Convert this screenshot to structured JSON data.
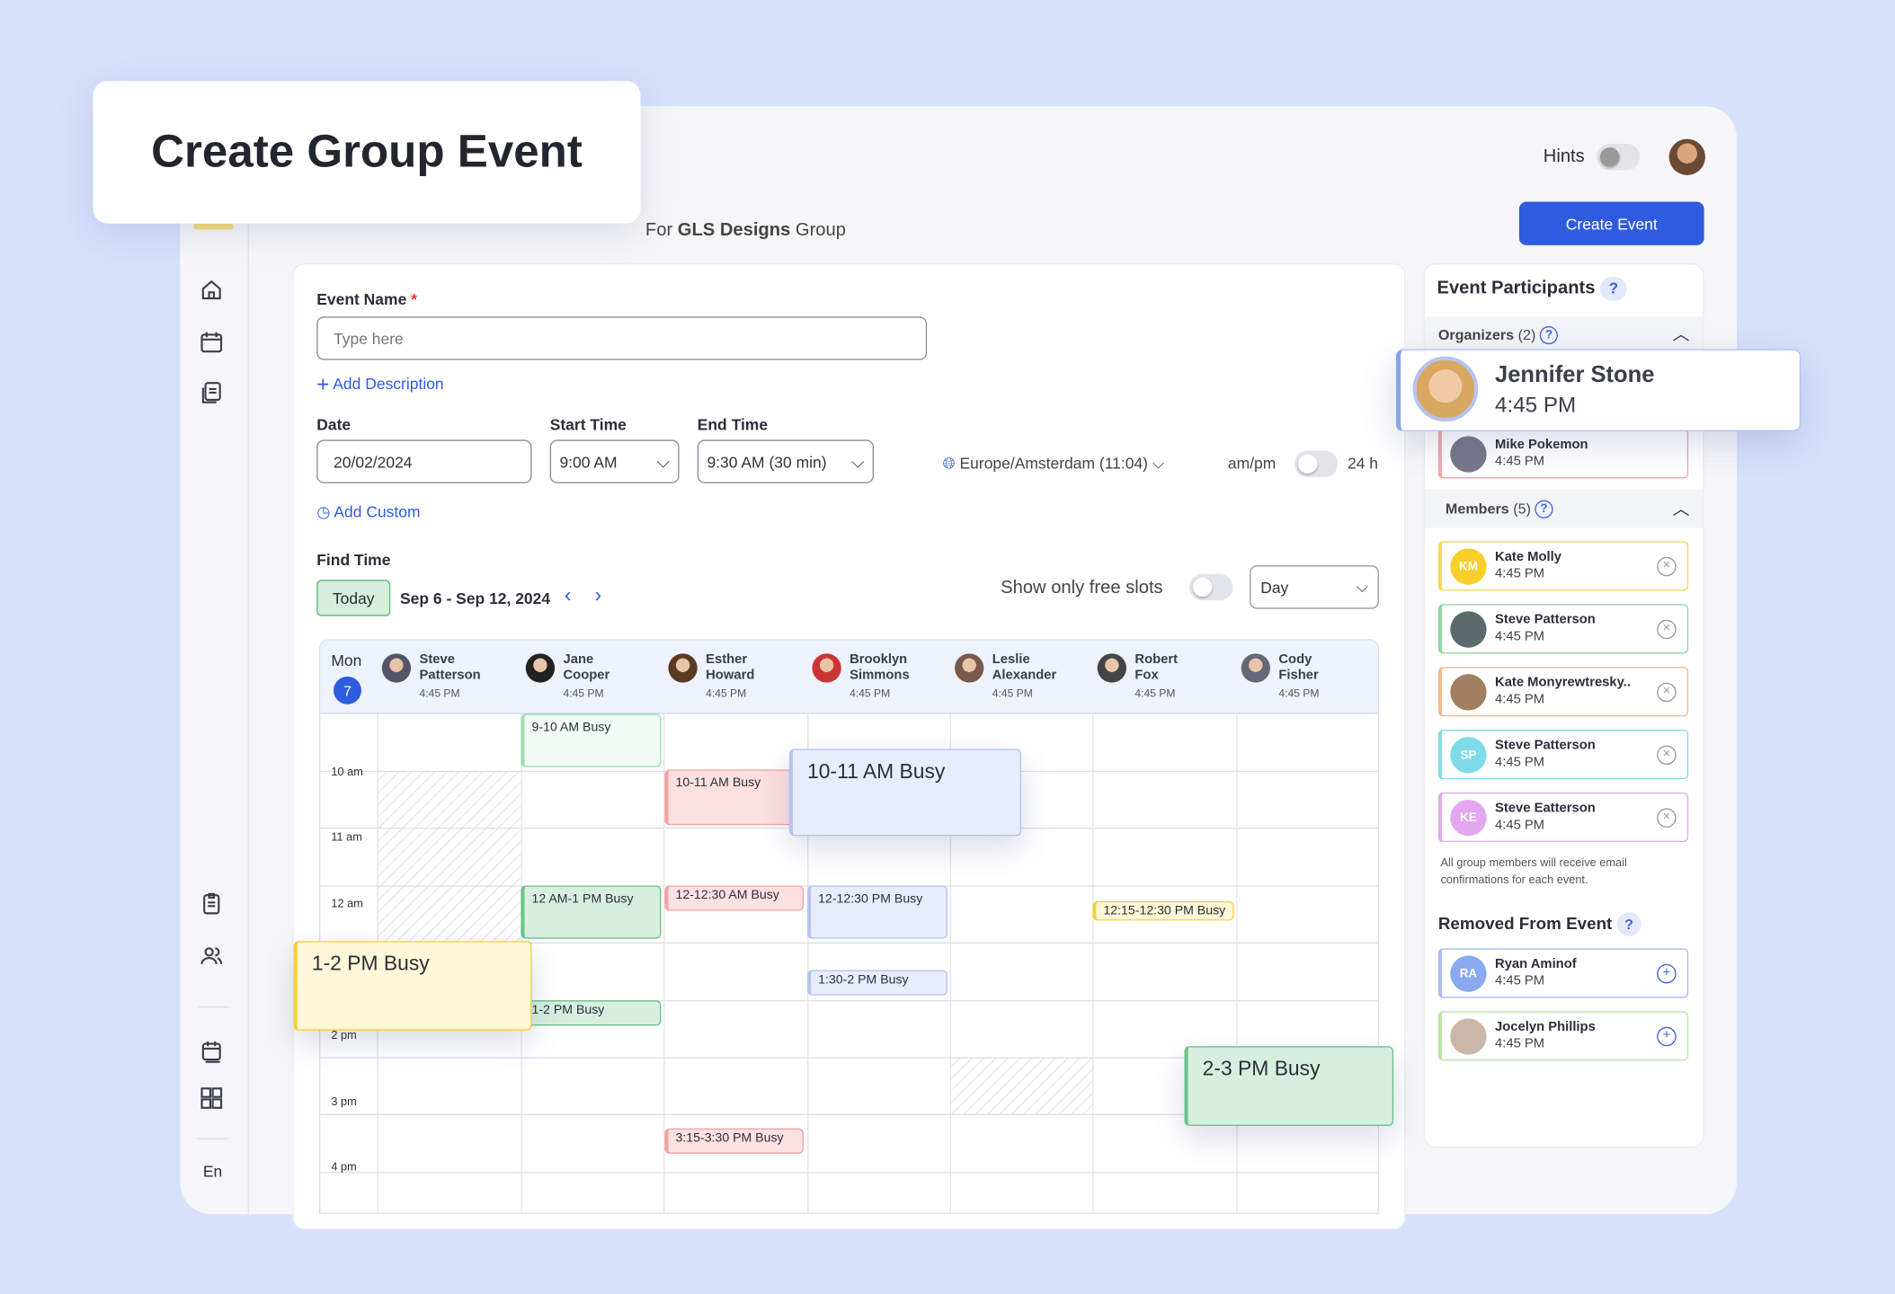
{
  "page_title": "Create Group Event",
  "header": {
    "hints_label": "Hints",
    "hints_on": false,
    "group_prefix": "For",
    "group_name": "GLS Designs",
    "group_suffix": "Group",
    "create_button": "Create Event"
  },
  "sidebar": {
    "icons": [
      "home-icon",
      "calendar-icon",
      "documents-icon",
      "clipboard-icon",
      "users-icon",
      "calendar-stack-icon",
      "grid-icon"
    ],
    "language": "En"
  },
  "form": {
    "event_name_label": "Event Name",
    "required_mark": "*",
    "event_name_placeholder": "Type here",
    "event_name_value": "",
    "add_description": "Add Description",
    "date_label": "Date",
    "date_value": "20/02/2024",
    "start_label": "Start Time",
    "start_value": "9:00 AM",
    "end_label": "End Time",
    "end_value": "9:30 AM (30 min)",
    "timezone": "Europe/Amsterdam (11:04)",
    "ampm_label": "am/pm",
    "h24_label": "24 h",
    "add_custom": "Add Custom",
    "find_time_label": "Find Time",
    "today_button": "Today",
    "date_range": "Sep 6 - Sep 12, 2024",
    "free_slots_label": "Show only free slots",
    "view_select": "Day"
  },
  "calendar": {
    "day_name": "Mon",
    "day_num": "7",
    "participants": [
      {
        "first": "Steve",
        "last": "Patterson",
        "time": "4:45 PM"
      },
      {
        "first": "Jane",
        "last": "Cooper",
        "time": "4:45 PM"
      },
      {
        "first": "Esther",
        "last": "Howard",
        "time": "4:45 PM"
      },
      {
        "first": "Brooklyn",
        "last": "Simmons",
        "time": "4:45 PM"
      },
      {
        "first": "Leslie",
        "last": "Alexander",
        "time": "4:45 PM"
      },
      {
        "first": "Robert",
        "last": "Fox",
        "time": "4:45 PM"
      },
      {
        "first": "Cody",
        "last": "Fisher",
        "time": "4:45 PM"
      }
    ],
    "hours": [
      "10 am",
      "11 am",
      "12 am",
      "2 pm",
      "3 pm",
      "4 pm"
    ],
    "events": [
      {
        "label": "9-10 AM Busy",
        "color": "green-light"
      },
      {
        "label": "10-11 AM Busy",
        "color": "red"
      },
      {
        "label": "12 AM-1 PM Busy",
        "color": "green"
      },
      {
        "label": "12-12:30 AM Busy",
        "color": "red"
      },
      {
        "label": "12-12:30 PM Busy",
        "color": "blue"
      },
      {
        "label": "12:15-12:30 PM Busy",
        "color": "yellow"
      },
      {
        "label": "1-2 PM Busy",
        "color": "green"
      },
      {
        "label": "1:30-2 PM Busy",
        "color": "blue"
      },
      {
        "label": "3:15-3:30 PM Busy",
        "color": "red"
      },
      {
        "label": "10-11 AM Busy",
        "color": "blue"
      },
      {
        "label": "1-2 PM Busy",
        "color": "yellow"
      },
      {
        "label": "2-3 PM Busy",
        "color": "green"
      }
    ]
  },
  "participants_panel": {
    "title": "Event Participants",
    "organizers_label": "Organizers",
    "organizers_count": "(2)",
    "highlight": {
      "name": "Jennifer Stone",
      "time": "4:45 PM"
    },
    "organizers": [
      {
        "name": "Mike Pokemon",
        "time": "4:45 PM",
        "accent": "#f4a7a7"
      }
    ],
    "members_label": "Members",
    "members_count": "(5)",
    "members": [
      {
        "name": "Kate Molly",
        "time": "4:45 PM",
        "initials": "KM",
        "accent": "#f8d64e",
        "avatar": "#f8cf2a"
      },
      {
        "name": "Steve Patterson",
        "time": "4:45 PM",
        "initials": "",
        "accent": "#8fd6a2",
        "avatar": "#5a6a6a"
      },
      {
        "name": "Kate Monyrewtresky..",
        "time": "4:45 PM",
        "initials": "",
        "accent": "#f9b98a",
        "avatar": "#a08060"
      },
      {
        "name": "Steve Patterson",
        "time": "4:45 PM",
        "initials": "SP",
        "accent": "#7fdbe8",
        "avatar": "#7fdbe8"
      },
      {
        "name": "Steve Eatterson",
        "time": "4:45 PM",
        "initials": "KE",
        "accent": "#e3a6ef",
        "avatar": "#e3a6ef"
      }
    ],
    "note": "All group members will receive email confirmations for each event.",
    "removed_title": "Removed From Event",
    "removed": [
      {
        "name": "Ryan Aminof",
        "time": "4:45 PM",
        "initials": "RA",
        "accent": "#a9bdf2",
        "avatar": "#8aa9f0"
      },
      {
        "name": "Jocelyn Phillips",
        "time": "4:45 PM",
        "initials": "",
        "accent": "#b9e6a4",
        "avatar": "#c9b8a8"
      }
    ]
  },
  "colors": {
    "accent": "#2f5be0",
    "background": "#d6e1fb"
  }
}
